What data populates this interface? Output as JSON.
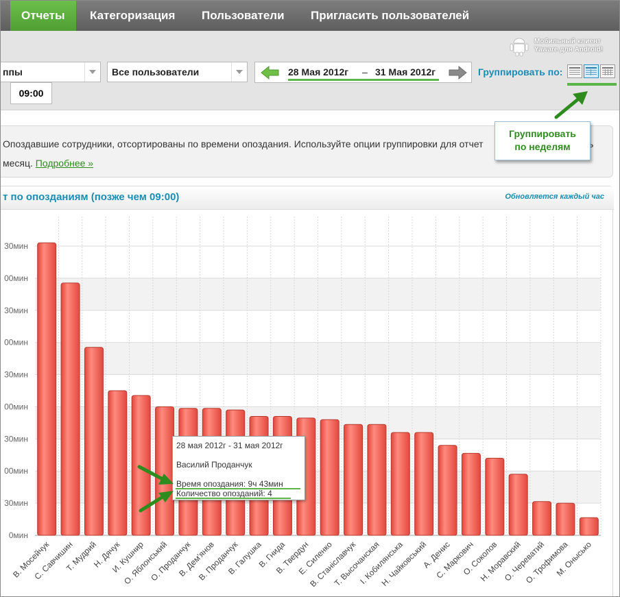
{
  "nav": {
    "tabs": [
      {
        "label": "Отчеты",
        "active": true
      },
      {
        "label": "Категоризация",
        "active": false
      },
      {
        "label": "Пользователи",
        "active": false
      },
      {
        "label": "Пригласить пользователей",
        "active": false
      }
    ]
  },
  "mobile_client": {
    "line1": "Мобильный клиент",
    "line2": "Yaware для Android!"
  },
  "filters": {
    "groups_select": "ппы",
    "users_select": "Все пользователи",
    "date_from": "28 Мая 2012г",
    "date_sep": "–",
    "date_to": "31 Мая 2012г",
    "time_value": "09:00",
    "group_by_label": "Группировать по:"
  },
  "callout": {
    "text1": "Группировать",
    "text2": "по неделям"
  },
  "info": {
    "line1": "Опоздавшие сотрудники, отсортированы по времени опоздания. Используйте опции группировки для отчет",
    "line1_tail": "ь",
    "line2": "месяц.",
    "link": "Подробнее »"
  },
  "chart_panel": {
    "title": "т по опозданиям (позже чем 09:00)",
    "updated": "Обновляется каждый час"
  },
  "tooltip": {
    "date_range": "28 мая 2012г - 31 мая 2012г",
    "name": "Василий Проданчук",
    "late_time": "Время опоздания: 9ч 43мин",
    "late_count": "Количество опозданий: 4"
  },
  "colors": {
    "accent_green": "#4f9f33",
    "title_blue": "#1a8db5",
    "bar_red": "#f2685e"
  },
  "chart_data": {
    "type": "bar",
    "title": "т по опозданиям (позже чем 09:00)",
    "categories": [
      "В. Мосейчук",
      "С. Савчишин",
      "Т. Мудрий",
      "Н. Дячук",
      "И. Кушнир",
      "О. Яблонський",
      "О. Проданчук",
      "В. Дем'янов",
      "В. Проданчук",
      "В. Галушка",
      "В. Гнида",
      "В. Твердун",
      "Е. Силенко",
      "В. Станіславчук",
      "Т. Высочанская",
      "І. Кобилянська",
      "Н. Чайковський",
      "А. Денис",
      "С. Маркович",
      "О. Соколов",
      "Н. Моравский",
      "О. Череватий",
      "О. Трофимова",
      "М. Онысько"
    ],
    "series": [
      {
        "values": [
          18.2,
          15.7,
          11.7,
          9.0,
          8.7,
          8.0,
          7.9,
          7.9,
          7.8,
          7.4,
          7.4,
          7.3,
          7.2,
          6.9,
          6.9,
          6.4,
          6.4,
          5.6,
          5.1,
          4.8,
          3.8,
          2.1,
          2.0,
          1.1
        ]
      }
    ],
    "ytick_labels": [
      "0мин",
      "30мин",
      "00мин",
      "30мин",
      "00мин",
      "30мин",
      "00мин",
      "30мин",
      "00мин",
      "30мин"
    ],
    "ylim": [
      0,
      18
    ],
    "grid": true
  }
}
